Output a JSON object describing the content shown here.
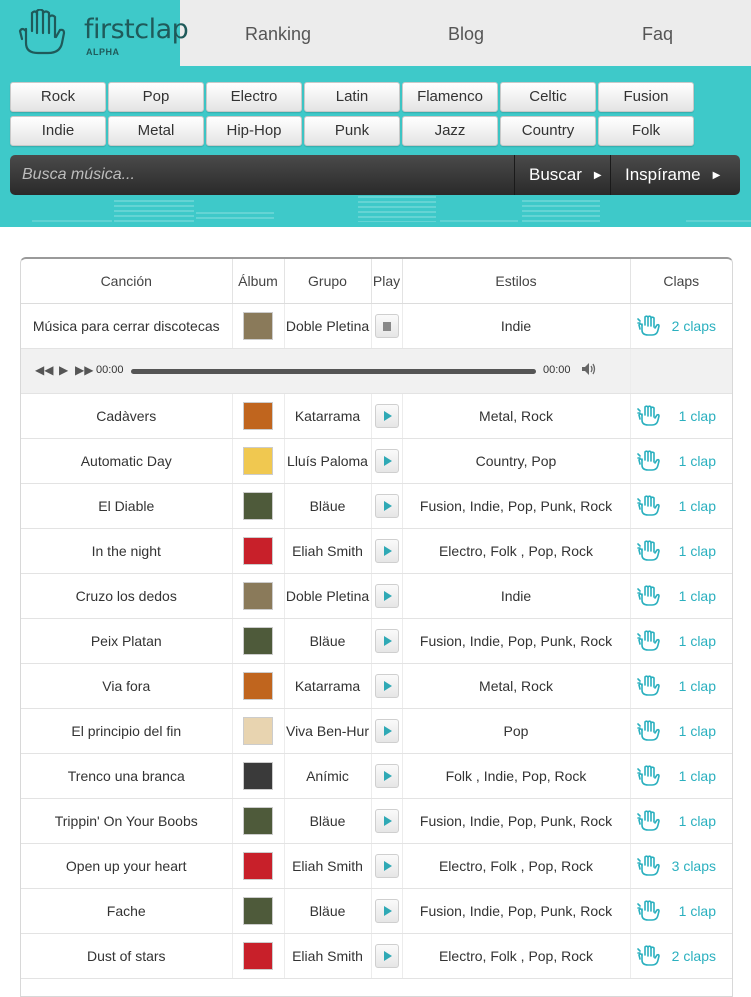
{
  "logo": {
    "name": "firstclap",
    "sub": "ALPHA"
  },
  "nav": {
    "ranking": "Ranking",
    "blog": "Blog",
    "faq": "Faq"
  },
  "genres_row1": [
    "Rock",
    "Pop",
    "Electro",
    "Latin",
    "Flamenco",
    "Celtic",
    "Fusion"
  ],
  "genres_row2": [
    "Indie",
    "Metal",
    "Hip-Hop",
    "Punk",
    "Jazz",
    "Country",
    "Folk"
  ],
  "search": {
    "placeholder": "Busca música...",
    "search_label": "Buscar",
    "inspire_label": "Inspírame"
  },
  "table": {
    "headers": {
      "song": "Canción",
      "album": "Álbum",
      "group": "Grupo",
      "play": "Play",
      "styles": "Estilos",
      "claps": "Claps"
    },
    "player": {
      "current_time": "00:00",
      "duration": "00:00",
      "progress": 0
    },
    "rows": [
      {
        "song": "Música para cerrar discotecas",
        "group": "Doble Pletina",
        "styles": "Indie",
        "claps": "2 claps",
        "playing": true,
        "art_color": "#8a7a5a"
      },
      {
        "song": "Cadàvers",
        "group": "Katarrama",
        "styles": "Metal, Rock",
        "claps": "1 clap",
        "playing": false,
        "art_color": "#c0651e"
      },
      {
        "song": "Automatic Day",
        "group": "Lluís Paloma",
        "styles": "Country, Pop",
        "claps": "1 clap",
        "playing": false,
        "art_color": "#f0c850"
      },
      {
        "song": "El Diable",
        "group": "Bläue",
        "styles": "Fusion, Indie, Pop, Punk, Rock",
        "claps": "1 clap",
        "playing": false,
        "art_color": "#4e5a3a"
      },
      {
        "song": "In the night",
        "group": "Eliah Smith",
        "styles": "Electro, Folk , Pop, Rock",
        "claps": "1 clap",
        "playing": false,
        "art_color": "#c8202a"
      },
      {
        "song": "Cruzo los dedos",
        "group": "Doble Pletina",
        "styles": "Indie",
        "claps": "1 clap",
        "playing": false,
        "art_color": "#8a7a5a"
      },
      {
        "song": "Peix Platan",
        "group": "Bläue",
        "styles": "Fusion, Indie, Pop, Punk, Rock",
        "claps": "1 clap",
        "playing": false,
        "art_color": "#4e5a3a"
      },
      {
        "song": "Via fora",
        "group": "Katarrama",
        "styles": "Metal, Rock",
        "claps": "1 clap",
        "playing": false,
        "art_color": "#c0651e"
      },
      {
        "song": "El principio del fin",
        "group": "Viva Ben-Hur",
        "styles": "Pop",
        "claps": "1 clap",
        "playing": false,
        "art_color": "#e8d4b0"
      },
      {
        "song": "Trenco una branca",
        "group": "Anímic",
        "styles": "Folk , Indie, Pop, Rock",
        "claps": "1 clap",
        "playing": false,
        "art_color": "#3a3a3a"
      },
      {
        "song": "Trippin' On Your Boobs",
        "group": "Bläue",
        "styles": "Fusion, Indie, Pop, Punk, Rock",
        "claps": "1 clap",
        "playing": false,
        "art_color": "#4e5a3a"
      },
      {
        "song": "Open up your heart",
        "group": "Eliah Smith",
        "styles": "Electro, Folk , Pop, Rock",
        "claps": "3 claps",
        "playing": false,
        "art_color": "#c8202a"
      },
      {
        "song": "Fache",
        "group": "Bläue",
        "styles": "Fusion, Indie, Pop, Punk, Rock",
        "claps": "1 clap",
        "playing": false,
        "art_color": "#4e5a3a"
      },
      {
        "song": "Dust of stars",
        "group": "Eliah Smith",
        "styles": "Electro, Folk , Pop, Rock",
        "claps": "2 claps",
        "playing": false,
        "art_color": "#c8202a"
      }
    ]
  },
  "colors": {
    "brand": "#3ec9c9",
    "accent_text": "#2bb0bf",
    "dark_bar": "#2a2a2a"
  }
}
